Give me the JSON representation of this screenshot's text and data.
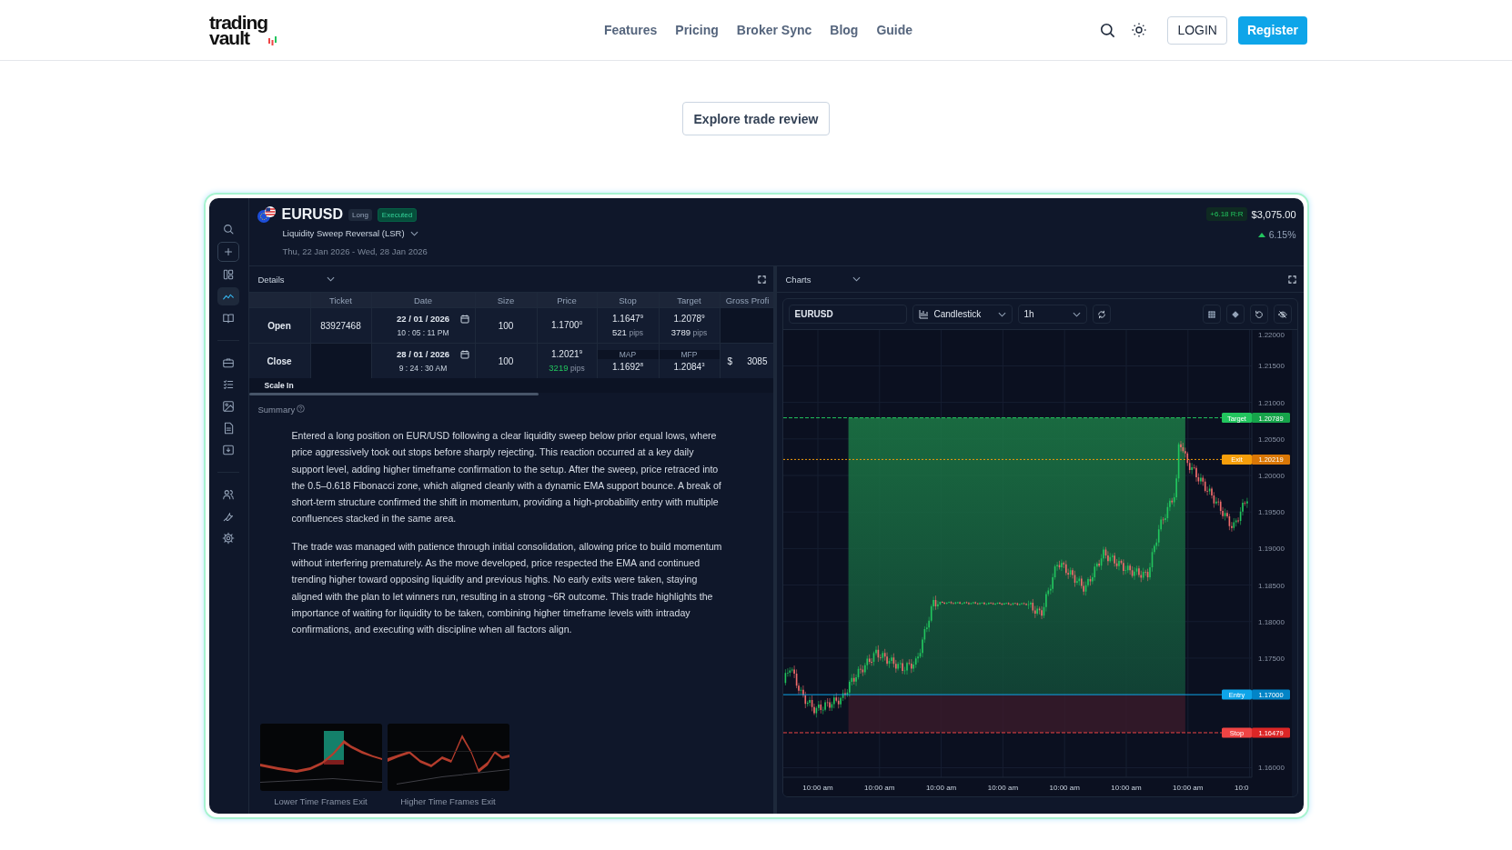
{
  "nav": {
    "logo": {
      "line_1": "trading",
      "line_2": "vault"
    },
    "links": [
      {
        "label": "Features"
      },
      {
        "label": "Pricing"
      },
      {
        "label": "Broker Sync"
      },
      {
        "label": "Blog"
      },
      {
        "label": "Guide"
      }
    ],
    "login": "LOGIN",
    "register": "Register"
  },
  "hero": {
    "button": "Explore trade review"
  },
  "app": {
    "sidebar": {
      "groups": [
        [
          {
            "selected": false
          },
          {
            "selected": false
          },
          {
            "selected": false
          },
          {
            "selected": true
          },
          {
            "selected": false
          }
        ],
        [
          {
            "selected": false
          },
          {
            "selected": false
          },
          {
            "selected": false
          },
          {
            "selected": false
          },
          {
            "selected": false
          }
        ],
        [
          {
            "selected": false
          },
          {
            "selected": false
          },
          {
            "selected": false
          }
        ]
      ]
    },
    "trade": {
      "symbol": "EURUSD",
      "tags": [
        {
          "label": "Long",
          "kind": "direction"
        },
        {
          "label": "Executed",
          "kind": "status"
        }
      ],
      "setup": "Liquidity Sweep Reversal (LSR)",
      "range": "Thu, 22 Jan 2026 - Wed, 28 Jan 2026",
      "rr": "+6.18 R:R",
      "pnl": "$3,075.00",
      "return": {
        "value": "6.15%",
        "rising": true
      }
    },
    "details": {
      "title": "Details",
      "table": {
        "columns": [
          "Ticket",
          "Date",
          "Size",
          "Price",
          "Stop",
          "Target",
          "Gross Profi"
        ],
        "rows": [
          {
            "label": "Open",
            "ticket": "83927468",
            "date": "22 / 01 / 2026",
            "time": "10 : 05 : 11 PM",
            "size": "100",
            "price": {
              "value": "1.1700$^{0}$"
            },
            "stop": {
              "value": "1.1647$^{9}$",
              "pips": "521",
              "unit": "pips",
              "gain": false
            },
            "target": {
              "value": "1.2078$^{9}$",
              "pips": "3789",
              "unit": "pips",
              "gain": false
            }
          },
          {
            "label": "Close",
            "date": "28 / 01 / 2026",
            "time": "9 : 24 : 30 AM",
            "size": "100",
            "price": {
              "value": "1.2021$^{9}$",
              "pips": "3219",
              "unit": "pips",
              "gain": true
            },
            "stop": {
              "caption": "MAP",
              "value": "1.1692$^{8}$"
            },
            "target": {
              "caption": "MFP",
              "value": "1.2084$^{3}$"
            },
            "gross": {
              "currency": "$",
              "amount": "3085"
            }
          }
        ]
      },
      "scale_in": "Scale In",
      "summary": {
        "label": "Summary",
        "paragraphs": [
          "Entered a long position on EUR/USD following a clear liquidity sweep below prior equal lows, where price aggressively took out stops before sharply rejecting. This reaction occurred at a key daily support level, adding higher timeframe confirmation to the setup. After the sweep, price retraced into the 0.5–0.618 Fibonacci zone, which aligned cleanly with a dynamic EMA support bounce. A break of short-term structure confirmed the shift in momentum, providing a high-probability entry with multiple confluences stacked in the same area.",
          "The trade was managed with patience through initial consolidation, allowing price to build momentum without interfering prematurely. As the move developed, price respected the EMA and continued trending higher toward opposing liquidity and previous highs. No early exits were taken, staying aligned with the plan to let winners run, resulting in a strong ~6R outcome. This trade highlights the importance of waiting for liquidity to be taken, combining higher timeframe levels with intraday confirmations, and executing with discipline when all factors align."
        ]
      },
      "attachments": [
        {
          "caption": "Lower Time Frames Exit",
          "kind": "picture"
        },
        {
          "caption": "Higher Time Frames Exit",
          "kind": "picture"
        }
      ]
    },
    "charts": {
      "title": "Charts",
      "symbol": "EURUSD",
      "chart_type": "Candlestick",
      "interval": "1h",
      "price_ticks": [
        "1.22000",
        "1.21500",
        "1.21000",
        "1.20500",
        "1.20000",
        "1.19500",
        "1.19000",
        "1.18500",
        "1.18000",
        "1.17500",
        "1.16000"
      ],
      "time_ticks": [
        "10:00 am",
        "10:00 am",
        "10:00 am",
        "10:00 am",
        "10:00 am",
        "10:00 am",
        "10:00 am",
        "10:0"
      ],
      "levels": [
        {
          "label": "Target",
          "value": "1.20789",
          "kind": "target"
        },
        {
          "label": "Exit",
          "value": "1.20219",
          "kind": "exit"
        },
        {
          "label": "Entry",
          "value": "1.17000",
          "kind": "entry"
        },
        {
          "label": "Stop",
          "value": "1.16479",
          "kind": "stop"
        }
      ]
    }
  }
}
